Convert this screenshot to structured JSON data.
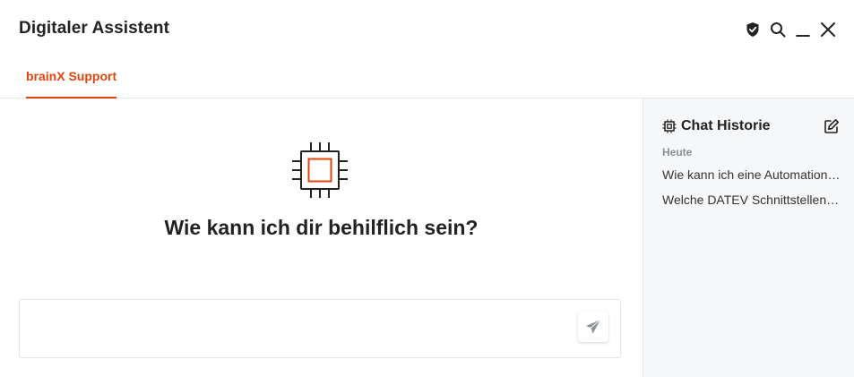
{
  "window": {
    "title": "Digitaler Assistent"
  },
  "header": {
    "actions": [
      {
        "icon": "shield-check-icon"
      },
      {
        "icon": "search-icon"
      },
      {
        "icon": "minimize-icon"
      },
      {
        "icon": "close-icon"
      }
    ]
  },
  "tabs": [
    {
      "label": "brainX Support",
      "active": true
    }
  ],
  "main": {
    "icon": "chip-icon",
    "welcome": "Wie kann ich dir behilflich sein?",
    "input": {
      "value": "",
      "placeholder": ""
    },
    "send_icon": "send-icon"
  },
  "sidebar": {
    "title": "Chat Historie",
    "title_icon": "chip-icon",
    "edit_icon": "edit-icon",
    "section": "Heute",
    "items": [
      {
        "label": "Wie kann ich eine Automation …"
      },
      {
        "label": "Welche DATEV Schnittstellen …"
      }
    ]
  },
  "colors": {
    "accent": "#e0440e",
    "text": "#222222",
    "muted": "#8a8f99",
    "sidebar_bg": "#f6f7f9",
    "border": "#e6e6e6"
  }
}
